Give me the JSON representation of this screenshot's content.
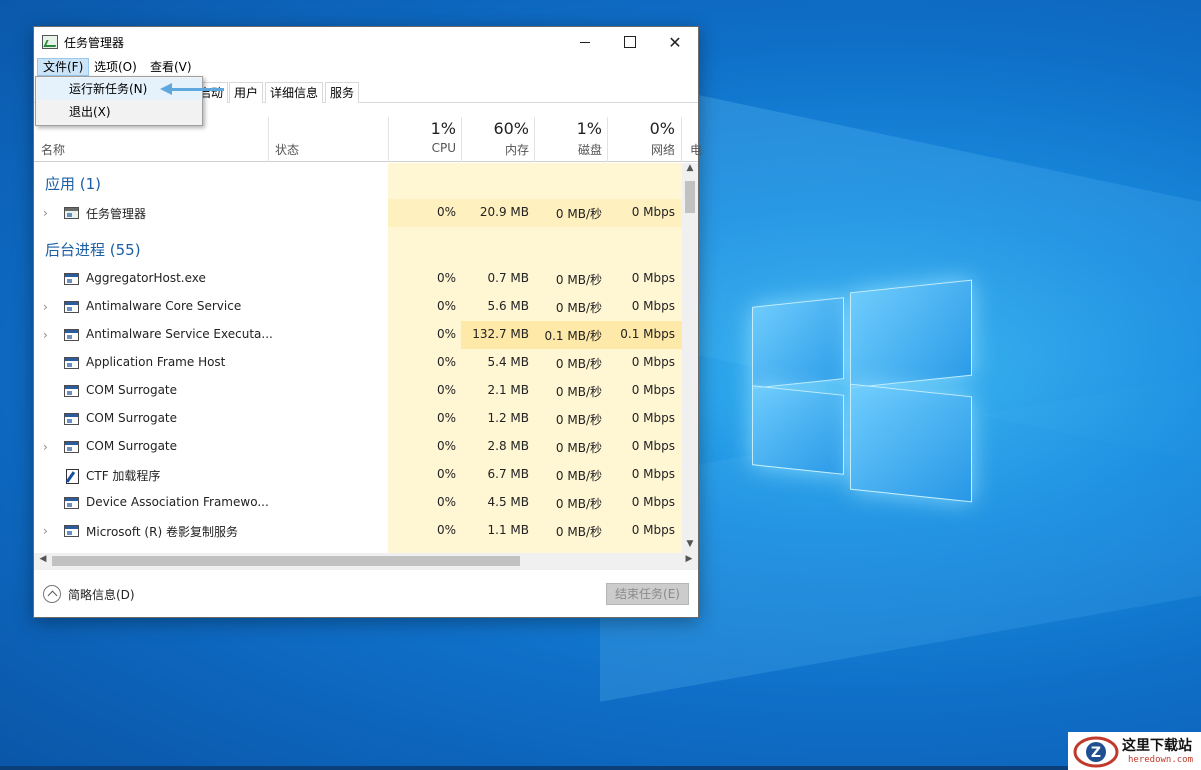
{
  "window": {
    "title": "任务管理器",
    "controls": {
      "minimize": "",
      "maximize": "",
      "close": "✕"
    }
  },
  "menubar": [
    "文件(F)",
    "选项(O)",
    "查看(V)"
  ],
  "file_menu": {
    "items": [
      "运行新任务(N)",
      "退出(X)"
    ]
  },
  "tabs": [
    "启动",
    "用户",
    "详细信息",
    "服务"
  ],
  "columns": {
    "name": "名称",
    "status": "状态",
    "cpu": {
      "pct": "1%",
      "label": "CPU"
    },
    "memory": {
      "pct": "60%",
      "label": "内存"
    },
    "disk": {
      "pct": "1%",
      "label": "磁盘"
    },
    "network": {
      "pct": "0%",
      "label": "网络"
    },
    "power_partial": "电"
  },
  "groups": {
    "apps": "应用 (1)",
    "background": "后台进程 (55)"
  },
  "apps": [
    {
      "name": "任务管理器",
      "cpu": "0%",
      "mem": "20.9 MB",
      "disk": "0 MB/秒",
      "net": "0 Mbps"
    }
  ],
  "background": [
    {
      "name": "AggregatorHost.exe",
      "cpu": "0%",
      "mem": "0.7 MB",
      "disk": "0 MB/秒",
      "net": "0 Mbps"
    },
    {
      "name": "Antimalware Core Service",
      "cpu": "0%",
      "mem": "5.6 MB",
      "disk": "0 MB/秒",
      "net": "0 Mbps"
    },
    {
      "name": "Antimalware Service Executa...",
      "cpu": "0%",
      "mem": "132.7 MB",
      "disk": "0.1 MB/秒",
      "net": "0.1 Mbps"
    },
    {
      "name": "Application Frame Host",
      "cpu": "0%",
      "mem": "5.4 MB",
      "disk": "0 MB/秒",
      "net": "0 Mbps"
    },
    {
      "name": "COM Surrogate",
      "cpu": "0%",
      "mem": "2.1 MB",
      "disk": "0 MB/秒",
      "net": "0 Mbps"
    },
    {
      "name": "COM Surrogate",
      "cpu": "0%",
      "mem": "1.2 MB",
      "disk": "0 MB/秒",
      "net": "0 Mbps"
    },
    {
      "name": "COM Surrogate",
      "cpu": "0%",
      "mem": "2.8 MB",
      "disk": "0 MB/秒",
      "net": "0 Mbps"
    },
    {
      "name": "CTF 加载程序",
      "cpu": "0%",
      "mem": "6.7 MB",
      "disk": "0 MB/秒",
      "net": "0 Mbps"
    },
    {
      "name": "Device Association Framewo...",
      "cpu": "0%",
      "mem": "4.5 MB",
      "disk": "0 MB/秒",
      "net": "0 Mbps"
    },
    {
      "name": "Microsoft (R) 卷影复制服务",
      "cpu": "0%",
      "mem": "1.1 MB",
      "disk": "0 MB/秒",
      "net": "0 Mbps"
    }
  ],
  "footer": {
    "fewer_details": "简略信息(D)",
    "end_task": "结束任务(E)"
  },
  "scroll": {
    "up": "▲",
    "down": "▼",
    "left": "◀",
    "right": "▶"
  },
  "expand_glyph": "›",
  "watermark": {
    "text": "这里下载站",
    "url": "heredown.com"
  },
  "colors": {
    "group_heading": "#1c5fa5",
    "heat_light": "#fff6d4",
    "heat_medium": "#ffe9a8",
    "arrow": "#5fa8de"
  }
}
